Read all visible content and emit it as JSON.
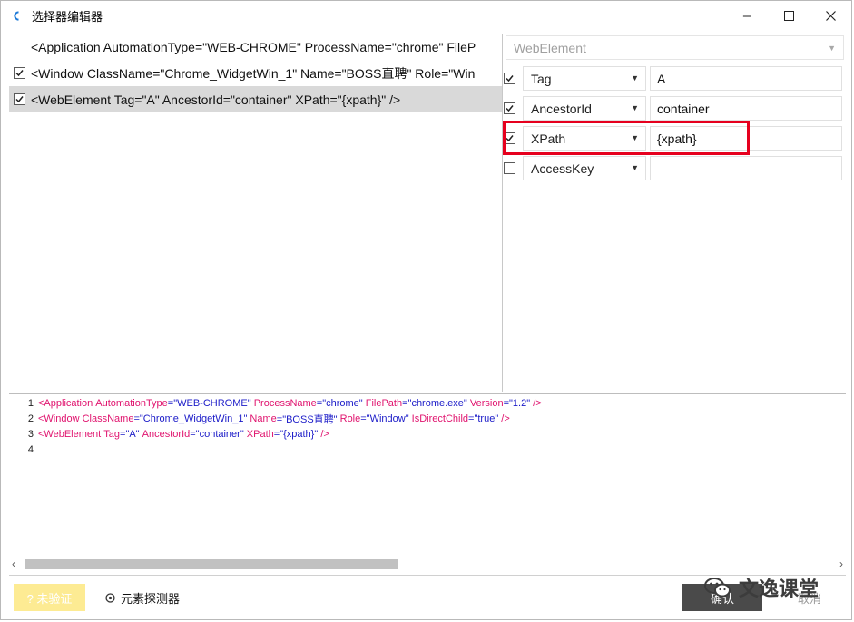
{
  "window": {
    "title": "选择器编辑器",
    "controls": {
      "minimize": "–",
      "maximize": "☐",
      "close": "✕"
    }
  },
  "tree": {
    "rows": [
      {
        "text": "<Application AutomationType=\"WEB-CHROME\" ProcessName=\"chrome\" FileP",
        "checkbox": false,
        "checked": false
      },
      {
        "text": "<Window ClassName=\"Chrome_WidgetWin_1\" Name=\"BOSS直聘\" Role=\"Win",
        "checkbox": true,
        "checked": true
      },
      {
        "text": "<WebElement Tag=\"A\" AncestorId=\"container\" XPath=\"{xpath}\" />",
        "checkbox": true,
        "checked": true
      }
    ]
  },
  "props": {
    "element_type": "WebElement",
    "rows": [
      {
        "name": "Tag",
        "value": "A",
        "checked": true
      },
      {
        "name": "AncestorId",
        "value": "container",
        "checked": true
      },
      {
        "name": "XPath",
        "value": "{xpath}",
        "checked": true
      },
      {
        "name": "AccessKey",
        "value": "",
        "checked": false
      }
    ]
  },
  "code": {
    "lines": [
      {
        "num": "1",
        "segments": [
          {
            "t": "<Application ",
            "c": "tag"
          },
          {
            "t": "AutomationType",
            "c": "attr"
          },
          {
            "t": "=\"WEB-CHROME\" ",
            "c": "str"
          },
          {
            "t": "ProcessName",
            "c": "attr"
          },
          {
            "t": "=\"chrome\" ",
            "c": "str"
          },
          {
            "t": "FilePath",
            "c": "attr"
          },
          {
            "t": "=\"chrome.exe\" ",
            "c": "str"
          },
          {
            "t": "Version",
            "c": "attr"
          },
          {
            "t": "=\"1.2\" ",
            "c": "str"
          },
          {
            "t": "/>",
            "c": "tag"
          }
        ]
      },
      {
        "num": "2",
        "segments": [
          {
            "t": "<Window ",
            "c": "tag"
          },
          {
            "t": "ClassName",
            "c": "attr"
          },
          {
            "t": "=\"Chrome_WidgetWin_1\" ",
            "c": "str"
          },
          {
            "t": "Name",
            "c": "attr"
          },
          {
            "t": "=\"BOSS直聘\" ",
            "c": "str"
          },
          {
            "t": "Role",
            "c": "attr"
          },
          {
            "t": "=\"Window\" ",
            "c": "str"
          },
          {
            "t": "IsDirectChild",
            "c": "attr"
          },
          {
            "t": "=\"true\" ",
            "c": "str"
          },
          {
            "t": "/>",
            "c": "tag"
          }
        ]
      },
      {
        "num": "3",
        "segments": [
          {
            "t": "<WebElement ",
            "c": "tag"
          },
          {
            "t": "Tag",
            "c": "attr"
          },
          {
            "t": "=\"A\" ",
            "c": "str"
          },
          {
            "t": "AncestorId",
            "c": "attr"
          },
          {
            "t": "=\"container\" ",
            "c": "str"
          },
          {
            "t": "XPath",
            "c": "attr"
          },
          {
            "t": "=\"{xpath}\" ",
            "c": "str"
          },
          {
            "t": "/>",
            "c": "tag"
          }
        ]
      },
      {
        "num": "4",
        "segments": []
      }
    ]
  },
  "bottom": {
    "unverified_label": "? 未验证",
    "probe_label": "元素探测器",
    "ok_label": "确认",
    "cancel_label": "取消",
    "watermark": "文逸课堂"
  },
  "colors": {
    "highlight": "#e6001e",
    "tag": "#e0136e",
    "string": "#1b1bc8",
    "unverified_bg": "#fdeb93"
  }
}
